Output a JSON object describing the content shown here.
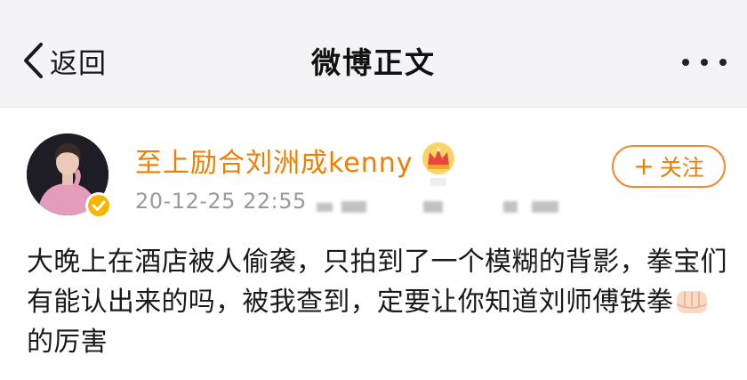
{
  "header": {
    "back_label": "返回",
    "title": "微博正文"
  },
  "post": {
    "username": "至上励合刘洲成kenny",
    "timestamp": "20-12-25 22:55",
    "follow_label": "关注",
    "text_part1": "大晚上在酒店被人偷袭，只拍到了一个模糊的背影，拳宝们有能认出来的吗，被我查到，定要让你知道刘师傅铁拳",
    "text_part2": "的厉害"
  },
  "colors": {
    "accent": "#f07e00",
    "header_bg": "#f4f4f6",
    "timestamp": "#9a9a9a"
  },
  "icons": [
    "back-chevron-icon",
    "more-dots-icon",
    "crown-icon",
    "verified-badge-icon",
    "plus-icon",
    "fist-emoji-icon"
  ]
}
